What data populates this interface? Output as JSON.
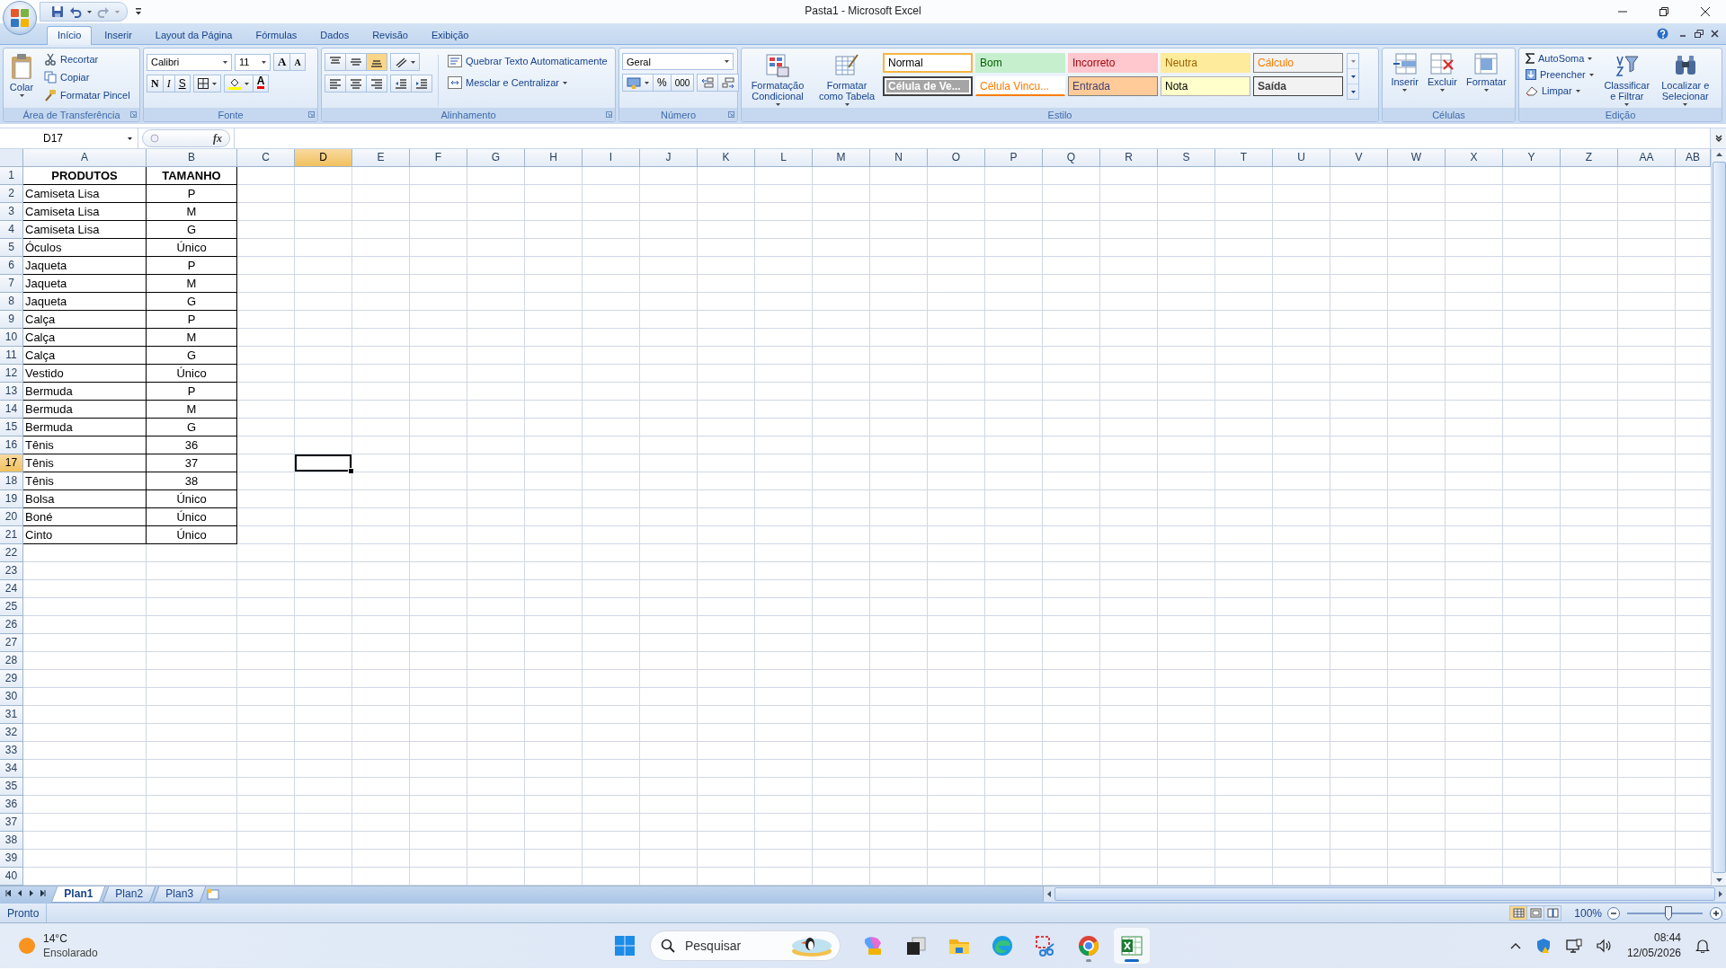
{
  "title_bar": {
    "title": "Pasta1 - Microsoft Excel"
  },
  "ribbon_tabs": [
    {
      "label": "Início",
      "selected": true
    },
    {
      "label": "Inserir",
      "selected": false
    },
    {
      "label": "Layout da Página",
      "selected": false
    },
    {
      "label": "Fórmulas",
      "selected": false
    },
    {
      "label": "Dados",
      "selected": false
    },
    {
      "label": "Revisão",
      "selected": false
    },
    {
      "label": "Exibição",
      "selected": false
    }
  ],
  "clipboard": {
    "group_label": "Área de Transferência",
    "paste": "Colar",
    "cut": "Recortar",
    "copy": "Copiar",
    "format_painter": "Formatar Pincel"
  },
  "font": {
    "group_label": "Fonte",
    "font_name": "Calibri",
    "font_size": "11",
    "grow_font": "A",
    "shrink_font": "A",
    "bold": "N",
    "italic": "I",
    "underline": "S",
    "font_color": "A"
  },
  "alignment": {
    "group_label": "Alinhamento",
    "wrap_text": "Quebrar Texto Automaticamente",
    "merge_center": "Mesclar e Centralizar"
  },
  "number": {
    "group_label": "Número",
    "format": "Geral",
    "percent": "%",
    "thousands": "000"
  },
  "styles": {
    "group_label": "Estilo",
    "conditional_formatting": "Formatação Condicional",
    "format_as_table": "Formatar como Tabela",
    "cell_styles": [
      {
        "label": "Normal",
        "kind": "normal"
      },
      {
        "label": "Bom",
        "kind": "good"
      },
      {
        "label": "Incorreto",
        "kind": "bad"
      },
      {
        "label": "Neutra",
        "kind": "neutral"
      },
      {
        "label": "Cálculo",
        "kind": "calculation"
      },
      {
        "label": "Célula de Ve...",
        "kind": "check"
      },
      {
        "label": "Célula Vincu...",
        "kind": "linked"
      },
      {
        "label": "Entrada",
        "kind": "input"
      },
      {
        "label": "Nota",
        "kind": "note"
      },
      {
        "label": "Saída",
        "kind": "output"
      }
    ]
  },
  "cells": {
    "group_label": "Células",
    "insert": "Inserir",
    "delete": "Excluir",
    "format": "Formatar"
  },
  "editing": {
    "group_label": "Edição",
    "autosum": "AutoSoma",
    "fill": "Preencher",
    "clear": "Limpar",
    "sort_filter": "Classificar e Filtrar",
    "find_select": "Localizar e Selecionar"
  },
  "formula_bar": {
    "name_box": "D17",
    "function_label": "fx"
  },
  "sheet": {
    "columns": [
      {
        "label": "A",
        "selected": false
      },
      {
        "label": "B",
        "selected": false
      },
      {
        "label": "C",
        "selected": false
      },
      {
        "label": "D",
        "selected": true
      },
      {
        "label": "E",
        "selected": false
      },
      {
        "label": "F",
        "selected": false
      },
      {
        "label": "G",
        "selected": false
      },
      {
        "label": "H",
        "selected": false
      },
      {
        "label": "I",
        "selected": false
      },
      {
        "label": "J",
        "selected": false
      },
      {
        "label": "K",
        "selected": false
      },
      {
        "label": "L",
        "selected": false
      },
      {
        "label": "M",
        "selected": false
      },
      {
        "label": "N",
        "selected": false
      },
      {
        "label": "O",
        "selected": false
      },
      {
        "label": "P",
        "selected": false
      },
      {
        "label": "Q",
        "selected": false
      },
      {
        "label": "R",
        "selected": false
      },
      {
        "label": "S",
        "selected": false
      },
      {
        "label": "T",
        "selected": false
      },
      {
        "label": "U",
        "selected": false
      },
      {
        "label": "V",
        "selected": false
      },
      {
        "label": "W",
        "selected": false
      },
      {
        "label": "X",
        "selected": false
      },
      {
        "label": "Y",
        "selected": false
      },
      {
        "label": "Z",
        "selected": false
      },
      {
        "label": "AA",
        "selected": false
      },
      {
        "label": "AB",
        "selected": false
      }
    ],
    "rows": [
      {
        "label": "1",
        "selected": false,
        "kind": "header",
        "cells": [
          "PRODUTOS",
          "TAMANHO"
        ]
      },
      {
        "label": "2",
        "selected": false,
        "kind": "data",
        "cells": [
          "Camiseta Lisa",
          "P"
        ]
      },
      {
        "label": "3",
        "selected": false,
        "kind": "data",
        "cells": [
          "Camiseta Lisa",
          "M"
        ]
      },
      {
        "label": "4",
        "selected": false,
        "kind": "data",
        "cells": [
          "Camiseta Lisa",
          "G"
        ]
      },
      {
        "label": "5",
        "selected": false,
        "kind": "data",
        "cells": [
          "Óculos",
          "Único"
        ]
      },
      {
        "label": "6",
        "selected": false,
        "kind": "data",
        "cells": [
          "Jaqueta",
          "P"
        ]
      },
      {
        "label": "7",
        "selected": false,
        "kind": "data",
        "cells": [
          "Jaqueta",
          "M"
        ]
      },
      {
        "label": "8",
        "selected": false,
        "kind": "data",
        "cells": [
          "Jaqueta",
          "G"
        ]
      },
      {
        "label": "9",
        "selected": false,
        "kind": "data",
        "cells": [
          "Calça",
          "P"
        ]
      },
      {
        "label": "10",
        "selected": false,
        "kind": "data",
        "cells": [
          "Calça",
          "M"
        ]
      },
      {
        "label": "11",
        "selected": false,
        "kind": "data",
        "cells": [
          "Calça",
          "G"
        ]
      },
      {
        "label": "12",
        "selected": false,
        "kind": "data",
        "cells": [
          "Vestido",
          "Único"
        ]
      },
      {
        "label": "13",
        "selected": false,
        "kind": "data",
        "cells": [
          "Bermuda",
          "P"
        ]
      },
      {
        "label": "14",
        "selected": false,
        "kind": "data",
        "cells": [
          "Bermuda",
          "M"
        ]
      },
      {
        "label": "15",
        "selected": false,
        "kind": "data",
        "cells": [
          "Bermuda",
          "G"
        ]
      },
      {
        "label": "16",
        "selected": false,
        "kind": "data",
        "cells": [
          "Tênis",
          "36"
        ]
      },
      {
        "label": "17",
        "selected": true,
        "kind": "data",
        "cells": [
          "Tênis",
          "37"
        ]
      },
      {
        "label": "18",
        "selected": false,
        "kind": "data",
        "cells": [
          "Tênis",
          "38"
        ]
      },
      {
        "label": "19",
        "selected": false,
        "kind": "data",
        "cells": [
          "Bolsa",
          "Único"
        ]
      },
      {
        "label": "20",
        "selected": false,
        "kind": "data",
        "cells": [
          "Boné",
          "Único"
        ]
      },
      {
        "label": "21",
        "selected": false,
        "kind": "data",
        "cells": [
          "Cinto",
          "Único"
        ]
      },
      {
        "label": "22",
        "selected": false
      },
      {
        "label": "23",
        "selected": false
      },
      {
        "label": "24",
        "selected": false
      },
      {
        "label": "25",
        "selected": false
      },
      {
        "label": "26",
        "selected": false
      },
      {
        "label": "27",
        "selected": false
      },
      {
        "label": "28",
        "selected": false
      },
      {
        "label": "29",
        "selected": false
      },
      {
        "label": "30",
        "selected": false
      },
      {
        "label": "31",
        "selected": false
      },
      {
        "label": "32",
        "selected": false
      },
      {
        "label": "33",
        "selected": false
      },
      {
        "label": "34",
        "selected": false
      },
      {
        "label": "35",
        "selected": false
      },
      {
        "label": "36",
        "selected": false
      },
      {
        "label": "37",
        "selected": false
      },
      {
        "label": "38",
        "selected": false
      },
      {
        "label": "39",
        "selected": false
      },
      {
        "label": "40",
        "selected": false
      }
    ]
  },
  "sheet_tabs": [
    {
      "label": "Plan1",
      "selected": true
    },
    {
      "label": "Plan2",
      "selected": false
    },
    {
      "label": "Plan3",
      "selected": false
    }
  ],
  "status_bar": {
    "status": "Pronto",
    "views": [
      {
        "kind": "normal",
        "selected": true
      },
      {
        "kind": "layout",
        "selected": false
      },
      {
        "kind": "page_break",
        "selected": false
      }
    ],
    "zoom": "100%",
    "zoom_slider": {
      "level": 0.5
    }
  },
  "taskbar": {
    "weather": {
      "temperature": "14°C",
      "condition": "Ensolarado"
    },
    "search": {
      "placeholder": "Pesquisar"
    },
    "apps": [
      {
        "kind": "copilot",
        "running": false,
        "active": false
      },
      {
        "kind": "task_view",
        "running": false,
        "active": false
      },
      {
        "kind": "explorer",
        "running": false,
        "active": false
      },
      {
        "kind": "edge",
        "running": false,
        "active": false
      },
      {
        "kind": "snipping",
        "running": false,
        "active": false
      },
      {
        "kind": "chrome",
        "running": true,
        "active": false
      },
      {
        "kind": "excel",
        "running": true,
        "active": true
      }
    ],
    "clock": {
      "time": "08:44",
      "date": "12/05/2026"
    }
  }
}
